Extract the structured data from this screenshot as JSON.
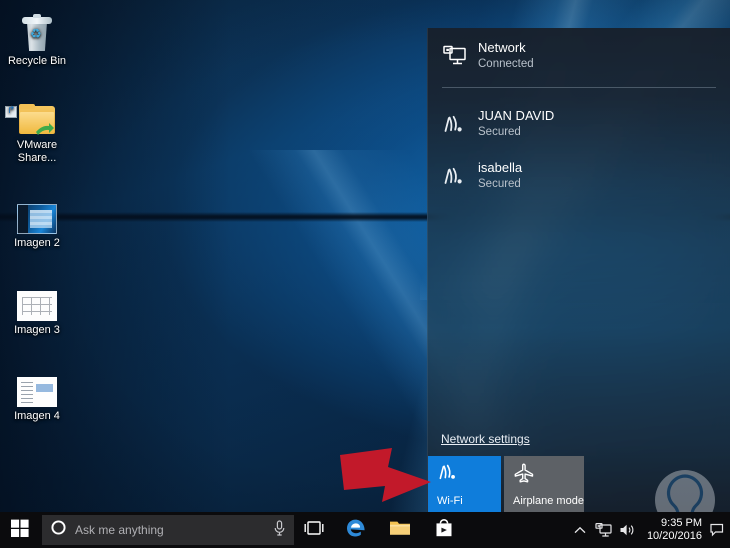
{
  "desktop": {
    "icons": [
      {
        "label": "Recycle Bin",
        "icon": "recycle-bin-icon"
      },
      {
        "label": "VMware Share...",
        "icon": "folder-shortcut-icon"
      },
      {
        "label": "Imagen 2",
        "icon": "image-thumbnail-icon"
      },
      {
        "label": "Imagen 3",
        "icon": "image-thumbnail-icon"
      },
      {
        "label": "Imagen 4",
        "icon": "image-thumbnail-icon"
      }
    ]
  },
  "flyout": {
    "ethernet": {
      "name": "Network",
      "status": "Connected",
      "icon": "ethernet-icon"
    },
    "networks": [
      {
        "name": "JUAN DAVID",
        "status": "Secured",
        "icon": "wifi-icon"
      },
      {
        "name": "isabella",
        "status": "Secured",
        "icon": "wifi-icon"
      }
    ],
    "settings_link": "Network settings",
    "tiles": [
      {
        "label": "Wi-Fi",
        "state": "on",
        "icon": "wifi-icon",
        "color": "#0f7ddb"
      },
      {
        "label": "Airplane mode",
        "state": "off",
        "icon": "airplane-icon",
        "color": "#5d6166"
      }
    ]
  },
  "taskbar": {
    "start_label": "Start",
    "search_placeholder": "Ask me anything",
    "cortana_icon": "cortana-circle-icon",
    "mic_icon": "microphone-icon",
    "taskview_icon": "task-view-icon",
    "apps": [
      {
        "name": "Microsoft Edge",
        "icon": "edge-icon"
      },
      {
        "name": "File Explorer",
        "icon": "file-explorer-icon"
      },
      {
        "name": "Microsoft Store",
        "icon": "store-icon"
      }
    ],
    "tray": {
      "overflow_icon": "chevron-up-icon",
      "network_icon": "network-icon",
      "volume_icon": "volume-icon",
      "time": "9:35 PM",
      "date": "10/20/2016",
      "action_center_icon": "action-center-icon"
    }
  },
  "annotation": {
    "arrow": "red-arrow-pointing-right",
    "arrow_color": "#c2192a"
  },
  "watermark": {
    "icon": "lightbulb-logo"
  }
}
